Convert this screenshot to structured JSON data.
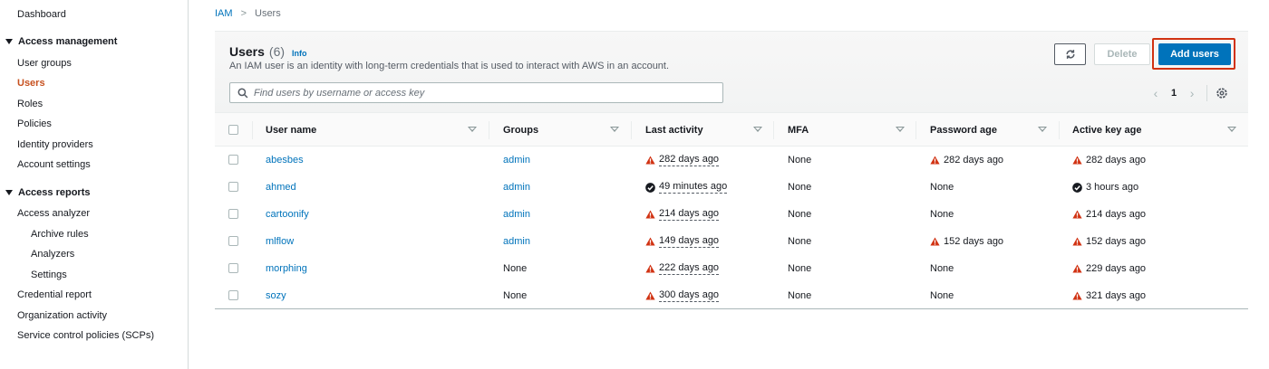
{
  "sidebar": {
    "dashboard": "Dashboard",
    "access_management": "Access management",
    "user_groups": "User groups",
    "users": "Users",
    "roles": "Roles",
    "policies": "Policies",
    "identity_providers": "Identity providers",
    "account_settings": "Account settings",
    "access_reports": "Access reports",
    "access_analyzer": "Access analyzer",
    "archive_rules": "Archive rules",
    "analyzers": "Analyzers",
    "settings": "Settings",
    "credential_report": "Credential report",
    "organization_activity": "Organization activity",
    "scps": "Service control policies (SCPs)"
  },
  "breadcrumb": {
    "root": "IAM",
    "separator": ">",
    "current": "Users"
  },
  "panel": {
    "title": "Users",
    "count": "(6)",
    "info": "Info",
    "description": "An IAM user is an identity with long-term credentials that is used to interact with AWS in an account.",
    "delete_label": "Delete",
    "add_label": "Add users",
    "search_placeholder": "Find users by username or access key",
    "page": "1"
  },
  "table": {
    "columns": {
      "username": "User name",
      "groups": "Groups",
      "last_activity": "Last activity",
      "mfa": "MFA",
      "password_age": "Password age",
      "active_key_age": "Active key age"
    },
    "rows": [
      {
        "username": "abesbes",
        "groups": "admin",
        "last_activity": "282 days ago",
        "mfa": "None",
        "password_age": "282 days ago",
        "active_key_age": "282 days ago"
      },
      {
        "username": "ahmed",
        "groups": "admin",
        "last_activity": "49 minutes ago",
        "mfa": "None",
        "password_age": "None",
        "active_key_age": "3 hours ago"
      },
      {
        "username": "cartoonify",
        "groups": "admin",
        "last_activity": "214 days ago",
        "mfa": "None",
        "password_age": "None",
        "active_key_age": "214 days ago"
      },
      {
        "username": "mlflow",
        "groups": "admin",
        "last_activity": "149 days ago",
        "mfa": "None",
        "password_age": "152 days ago",
        "active_key_age": "152 days ago"
      },
      {
        "username": "morphing",
        "groups": "None",
        "last_activity": "222 days ago",
        "mfa": "None",
        "password_age": "None",
        "active_key_age": "229 days ago"
      },
      {
        "username": "sozy",
        "groups": "None",
        "last_activity": "300 days ago",
        "mfa": "None",
        "password_age": "None",
        "active_key_age": "321 days ago"
      }
    ]
  },
  "colors": {
    "link": "#0073bb",
    "active_nav": "#c7511f",
    "primary_button": "#0073bb",
    "highlight_border": "#d13212",
    "warning": "#d13212",
    "success": "#16191f"
  },
  "icons": {
    "refresh": "refresh-icon",
    "search": "search-icon",
    "settings": "gear-icon",
    "warning": "warning-icon",
    "ok": "check-circle-icon"
  }
}
